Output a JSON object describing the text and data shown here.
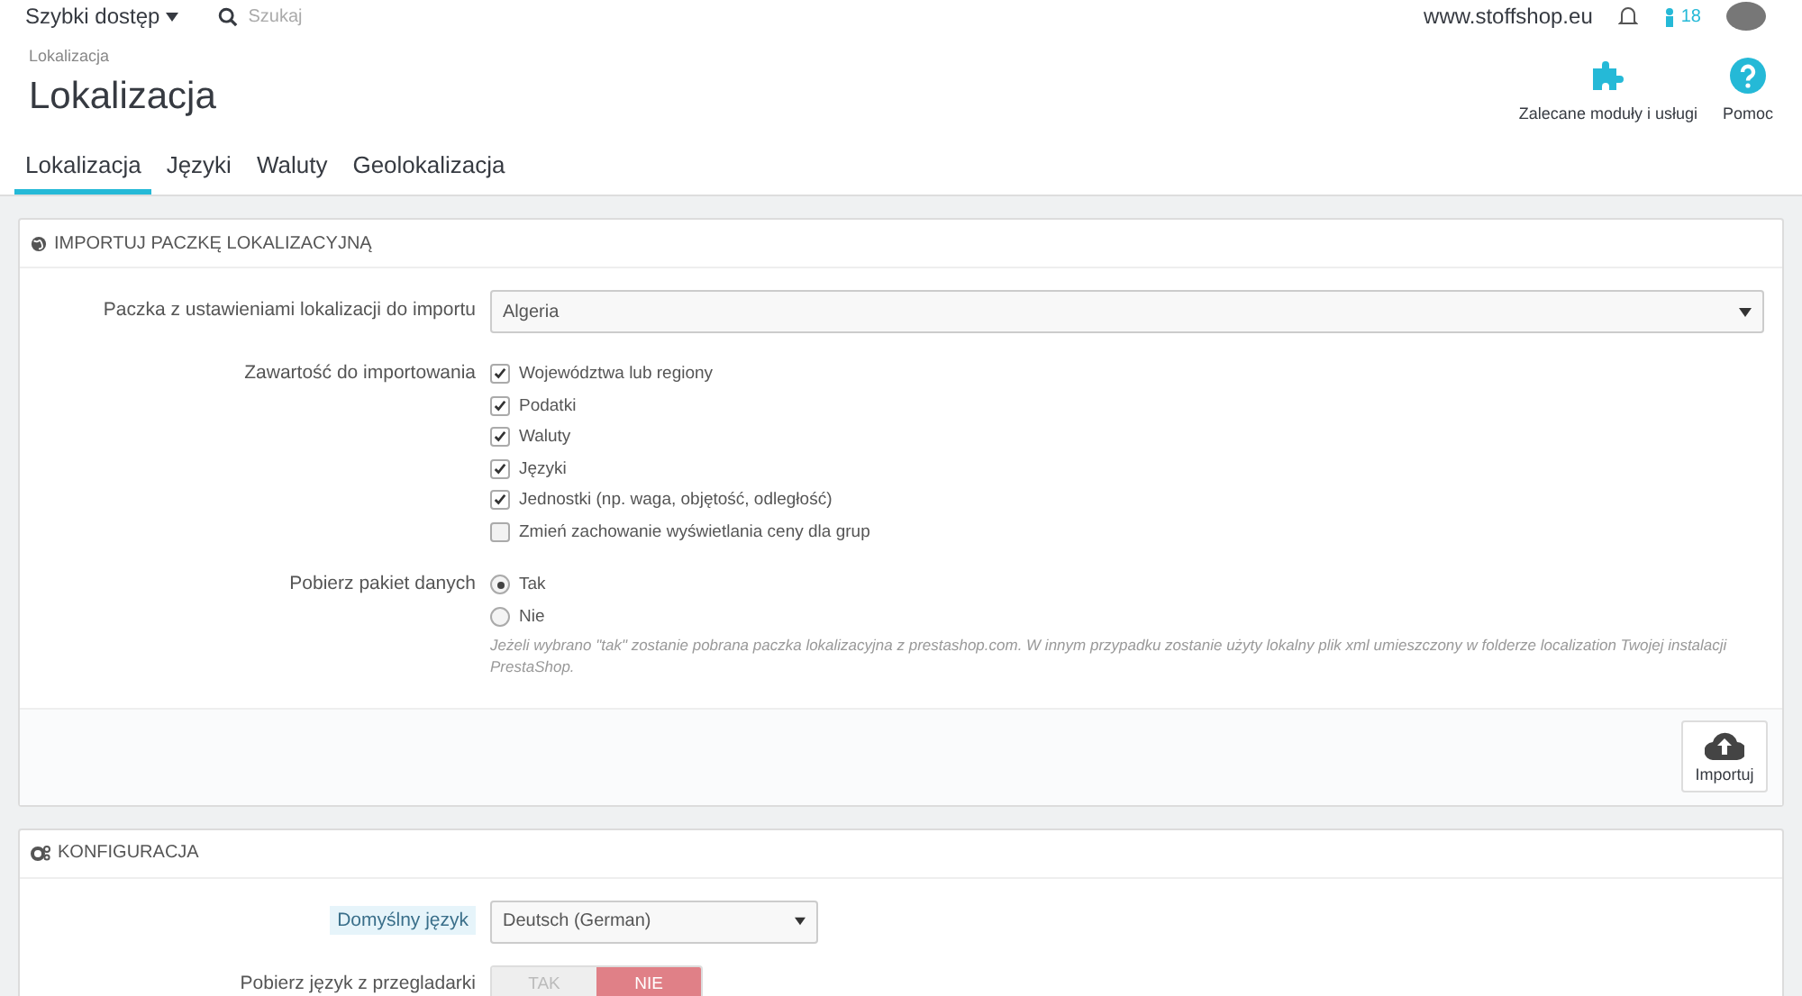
{
  "topbar": {
    "quick_access": "Szybki dostęp",
    "search": {
      "placeholder": "Szukaj"
    },
    "shop_url": "www.stoffshop.eu",
    "badge_count": "18"
  },
  "header": {
    "breadcrumb": "Lokalizacja",
    "title": "Lokalizacja",
    "toolbar": [
      {
        "label": "Zalecane moduły i usługi"
      },
      {
        "label": "Pomoc"
      }
    ]
  },
  "tabs": [
    {
      "label": "Lokalizacja",
      "selected": true
    },
    {
      "label": "Języki",
      "selected": false
    },
    {
      "label": "Waluty",
      "selected": false
    },
    {
      "label": "Geolokalizacja",
      "selected": false
    }
  ],
  "import_panel": {
    "heading": "IMPORTUJ PACZKĘ LOKALIZACYJNĄ",
    "pack": {
      "label": "Paczka z ustawieniami lokalizacji do importu",
      "value": "Algeria"
    },
    "content": {
      "label": "Zawartość do importowania",
      "options": [
        {
          "label": "Województwa lub regiony",
          "checked": true
        },
        {
          "label": "Podatki",
          "checked": true
        },
        {
          "label": "Waluty",
          "checked": true
        },
        {
          "label": "Języki",
          "checked": true
        },
        {
          "label": "Jednostki (np. waga, objętość, odległość)",
          "checked": true
        },
        {
          "label": "Zmień zachowanie wyświetlania ceny dla grup",
          "checked": false
        }
      ]
    },
    "download": {
      "label": "Pobierz pakiet danych",
      "options": [
        {
          "label": "Tak",
          "selected": true
        },
        {
          "label": "Nie",
          "selected": false
        }
      ],
      "help": "Jeżeli wybrano \"tak\" zostanie pobrana paczka lokalizacyjna z prestashop.com. W innym przypadku zostanie użyty lokalny plik xml umieszczony w folderze localization Twojej instalacji PrestaShop."
    },
    "button": "Importuj"
  },
  "config_panel": {
    "heading": "KONFIGURACJA",
    "default_language": {
      "label": "Domyślny język",
      "value": "Deutsch (German)"
    },
    "browser_language": {
      "label": "Pobierz język z przegladarki",
      "options": [
        {
          "label": "TAK",
          "selected": false
        },
        {
          "label": "NIE",
          "selected": true
        }
      ]
    }
  }
}
